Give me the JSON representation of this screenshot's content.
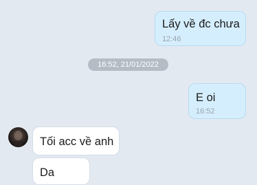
{
  "messages": [
    {
      "direction": "outgoing",
      "text": "Lấy về đc chưa",
      "time": "12:46"
    },
    {
      "direction": "outgoing",
      "text": "E oi",
      "time": "16:52"
    },
    {
      "direction": "incoming",
      "text": "Tối acc về anh"
    },
    {
      "direction": "incoming",
      "text": "Da"
    }
  ],
  "date_separator": "16:52, 21/01/2022",
  "colors": {
    "background": "#e2e9f1",
    "outgoing_bubble": "#d5eefd",
    "incoming_bubble": "#ffffff",
    "date_pill": "#b4bcc6"
  }
}
